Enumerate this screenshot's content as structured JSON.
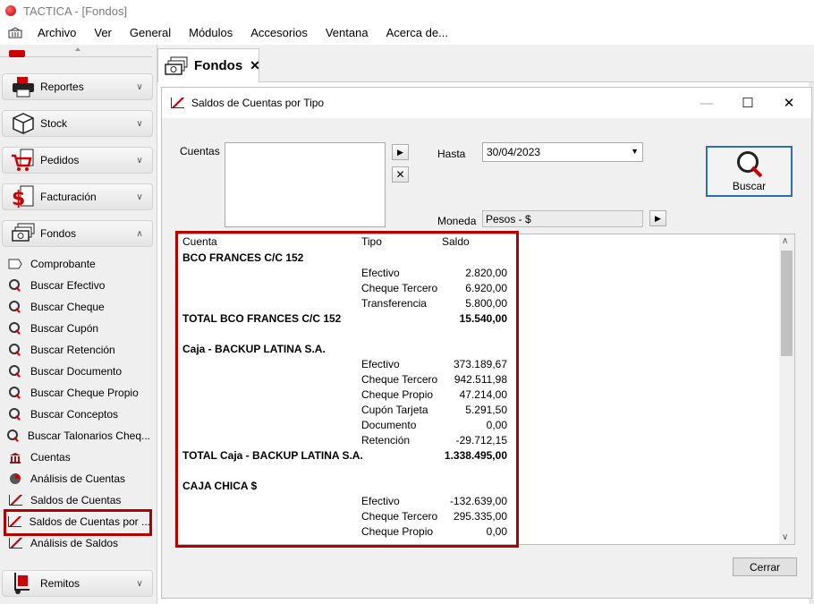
{
  "window": {
    "title": "TACTICA - [Fondos]"
  },
  "menu": {
    "items": [
      "Archivo",
      "Ver",
      "General",
      "Módulos",
      "Accesorios",
      "Ventana",
      "Acerca de..."
    ]
  },
  "sidebar": {
    "groups": [
      "Reportes",
      "Stock",
      "Pedidos",
      "Facturación",
      "Fondos",
      "Remitos"
    ],
    "fondos_items": [
      "Comprobante",
      "Buscar Efectivo",
      "Buscar Cheque",
      "Buscar Cupón",
      "Buscar Retención",
      "Buscar Documento",
      "Buscar Cheque Propio",
      "Buscar Conceptos",
      "Buscar Talonarios Cheq...",
      "Cuentas",
      "Análisis de Cuentas",
      "Saldos de Cuentas",
      "Saldos de Cuentas por ...",
      "Análisis de Saldos"
    ],
    "selected_item": "Saldos de Cuentas por ..."
  },
  "tab": {
    "label": "Fondos",
    "close": "✕"
  },
  "dialog": {
    "title": "Saldos de Cuentas por Tipo",
    "cuentas_label": "Cuentas",
    "hasta_label": "Hasta",
    "hasta_value": "30/04/2023",
    "moneda_label": "Moneda",
    "moneda_value": "Pesos - $",
    "buscar_label": "Buscar",
    "cerrar_label": "Cerrar"
  },
  "grid": {
    "columns": [
      "Cuenta",
      "Tipo",
      "Saldo"
    ],
    "rows": [
      {
        "cuenta": "BCO FRANCES C/C 152",
        "tipo": "",
        "saldo": "",
        "bold": true
      },
      {
        "cuenta": "",
        "tipo": "Efectivo",
        "saldo": "2.820,00",
        "bold": false
      },
      {
        "cuenta": "",
        "tipo": "Cheque Tercero",
        "saldo": "6.920,00",
        "bold": false
      },
      {
        "cuenta": "",
        "tipo": "Transferencia",
        "saldo": "5.800,00",
        "bold": false
      },
      {
        "cuenta": "TOTAL BCO FRANCES C/C 152",
        "tipo": "",
        "saldo": "15.540,00",
        "bold": true
      },
      {
        "cuenta": "",
        "tipo": "",
        "saldo": "",
        "bold": false
      },
      {
        "cuenta": "Caja - BACKUP LATINA S.A.",
        "tipo": "",
        "saldo": "",
        "bold": true
      },
      {
        "cuenta": "",
        "tipo": "Efectivo",
        "saldo": "373.189,67",
        "bold": false
      },
      {
        "cuenta": "",
        "tipo": "Cheque Tercero",
        "saldo": "942.511,98",
        "bold": false
      },
      {
        "cuenta": "",
        "tipo": "Cheque Propio",
        "saldo": "47.214,00",
        "bold": false
      },
      {
        "cuenta": "",
        "tipo": "Cupón Tarjeta",
        "saldo": "5.291,50",
        "bold": false
      },
      {
        "cuenta": "",
        "tipo": "Documento",
        "saldo": "0,00",
        "bold": false
      },
      {
        "cuenta": "",
        "tipo": "Retención",
        "saldo": "-29.712,15",
        "bold": false
      },
      {
        "cuenta": "TOTAL Caja - BACKUP LATINA S.A.",
        "tipo": "",
        "saldo": "1.338.495,00",
        "bold": true
      },
      {
        "cuenta": "",
        "tipo": "",
        "saldo": "",
        "bold": false
      },
      {
        "cuenta": "CAJA CHICA $",
        "tipo": "",
        "saldo": "",
        "bold": true
      },
      {
        "cuenta": "",
        "tipo": "Efectivo",
        "saldo": "-132.639,00",
        "bold": false
      },
      {
        "cuenta": "",
        "tipo": "Cheque Tercero",
        "saldo": "295.335,00",
        "bold": false
      },
      {
        "cuenta": "",
        "tipo": "Cheque Propio",
        "saldo": "0,00",
        "bold": false
      }
    ]
  },
  "colors": {
    "accent_red": "#b40000",
    "focus_blue": "#2a6fb8"
  }
}
